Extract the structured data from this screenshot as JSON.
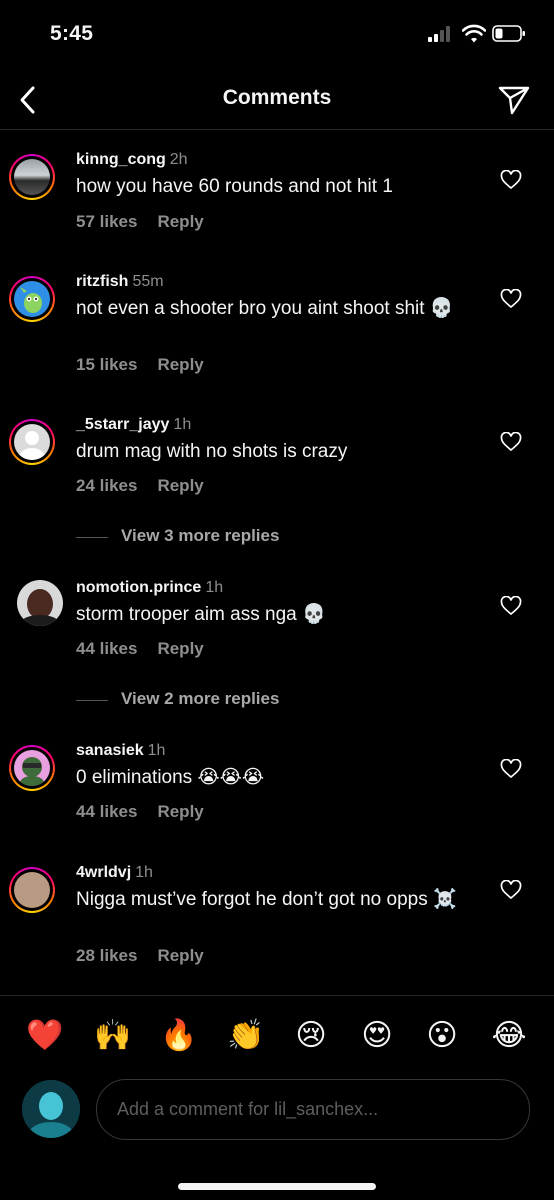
{
  "status_bar": {
    "time": "5:45"
  },
  "header": {
    "title": "Comments"
  },
  "comments": [
    {
      "username": "kinng_cong",
      "time": "2h",
      "text": "how you have 60 rounds and not hit 1",
      "likes": "57 likes",
      "reply": "Reply"
    },
    {
      "username": "ritzfish",
      "time": "55m",
      "text": "not even a shooter bro you aint shoot shit 💀",
      "likes": "15 likes",
      "reply": "Reply"
    },
    {
      "username": "_5starr_jayy",
      "time": "1h",
      "text": "drum mag with no shots is crazy",
      "likes": "24 likes",
      "reply": "Reply"
    },
    {
      "username": "nomotion.prince",
      "time": "1h",
      "text": "storm trooper aim ass nga 💀",
      "likes": "44 likes",
      "reply": "Reply"
    },
    {
      "username": "sanasiek",
      "time": "1h",
      "text": "0 eliminations 😭😭😭",
      "likes": "44 likes",
      "reply": "Reply"
    },
    {
      "username": "4wrldvj",
      "time": "1h",
      "text": "Nigga must’ve forgot he don’t got no opps ☠️",
      "likes": "28 likes",
      "reply": "Reply"
    }
  ],
  "view_more": [
    {
      "label": "View 3 more replies"
    },
    {
      "label": "View 2 more replies"
    }
  ],
  "emoji_bar": [
    "❤️",
    "🙌",
    "🔥",
    "👏",
    "😢",
    "😍",
    "😮",
    "😂"
  ],
  "input": {
    "placeholder": "Add a comment for lil_sanchex..."
  },
  "colors": {
    "background": "#000000",
    "secondary_text": "#8e8e8e",
    "story_ring": "#ff0069"
  }
}
